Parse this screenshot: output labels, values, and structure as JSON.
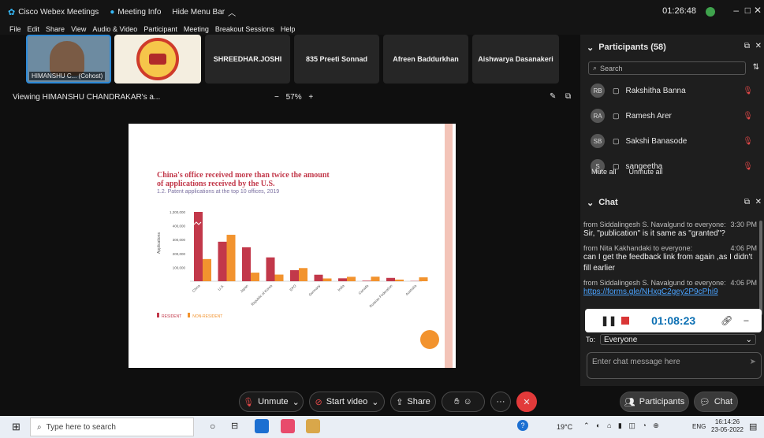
{
  "app": {
    "title": "Cisco Webex Meetings",
    "meeting_info": "Meeting Info",
    "hide_menu": "Hide Menu Bar",
    "clock": "01:26:48"
  },
  "menu": [
    "File",
    "Edit",
    "Share",
    "View",
    "Audio & Video",
    "Participant",
    "Meeting",
    "Breakout Sessions",
    "Help"
  ],
  "video_tiles": [
    {
      "label": "HIMANSHU C... (Cohost)"
    },
    {
      "label": ""
    },
    {
      "label": "SHREEDHAR.JOSHI"
    },
    {
      "label": "835 Preeti Sonnad"
    },
    {
      "label": "Afreen Baddurkhan"
    },
    {
      "label": "Aishwarya Dasanakeri"
    }
  ],
  "share": {
    "viewing": "Viewing HIMANSHU CHANDRAKAR's a...",
    "zoom": "57%",
    "zoom_minus": "−",
    "zoom_plus": "+"
  },
  "slide": {
    "title_line1": "China's office received more than twice the amount",
    "title_line2": "of applications received by the U.S.",
    "subtitle": "1.2. Patent applications at the top 10 offices, 2019",
    "legend_resident": "RESIDENT",
    "legend_non_resident": "NON-RESIDENT",
    "color_resident": "#c2384a",
    "color_non_resident": "#f2932e"
  },
  "chart_data": {
    "type": "bar",
    "title": "China's office received more than twice the amount of applications received by the U.S.",
    "subtitle": "1.2. Patent applications at the top 10 offices, 2019",
    "ylabel": "Applications",
    "categories": [
      "China",
      "U.S.",
      "Japan",
      "Republic of Korea",
      "EPO",
      "Germany",
      "India",
      "Canada",
      "Russian Federation",
      "Australia"
    ],
    "yticks": [
      "100,000",
      "200,000",
      "300,000",
      "400,000",
      "1,300,000"
    ],
    "series": [
      {
        "name": "RESIDENT",
        "values": [
          1240000,
          285000,
          245000,
          172000,
          80000,
          47000,
          21000,
          4000,
          24000,
          2000
        ]
      },
      {
        "name": "NON-RESIDENT",
        "values": [
          160000,
          335000,
          62000,
          48000,
          95000,
          20000,
          32000,
          33000,
          12000,
          28000
        ]
      }
    ],
    "ylim": [
      0,
      500000
    ]
  },
  "participants": {
    "header": "Participants (58)",
    "search_placeholder": "Search",
    "list": [
      {
        "initials": "RB",
        "name": "Rakshitha Banna"
      },
      {
        "initials": "RA",
        "name": "Ramesh Arer"
      },
      {
        "initials": "SB",
        "name": "Sakshi Banasode"
      },
      {
        "initials": "S",
        "name": "sangeetha"
      }
    ],
    "mute_all": "Mute all",
    "unmute_all": "Unmute all"
  },
  "chat": {
    "header": "Chat",
    "messages": [
      {
        "from": "from Siddalingesh S. Navalgund to everyone:",
        "time": "3:30 PM",
        "text": "Sir, \"publication\" is it same as \"granted\"?"
      },
      {
        "from": "from Nita Kakhandaki to everyone:",
        "time": "4:06 PM",
        "text": "can I get the feedback link from again ,as I didn't fill earlier"
      },
      {
        "from": "from Siddalingesh S. Navalgund to everyone:",
        "time": "4:06 PM",
        "text": "https://forms.gle/NHxgC2gey2P9cPhi9"
      }
    ],
    "recorder_time": "01:08:23",
    "to_label": "To:",
    "to_value": "Everyone",
    "input_placeholder": "Enter chat message here"
  },
  "controls": {
    "mute": "Unmute",
    "video": "Start video",
    "share": "Share",
    "more": "···",
    "participants": "Participants",
    "chat": "Chat"
  },
  "taskbar": {
    "search_placeholder": "Type here to search",
    "temp": "19°C",
    "lang": "ENG",
    "time": "16:14:26",
    "date": "23-05-2022"
  }
}
